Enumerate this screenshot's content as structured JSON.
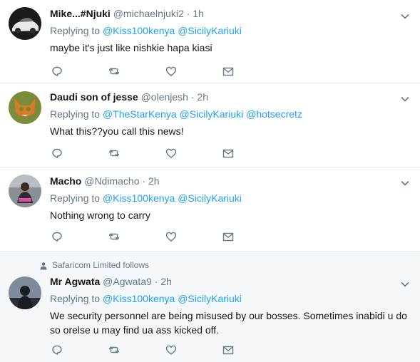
{
  "tweets": [
    {
      "name": "Mike...#Njuki",
      "handle": "@michaelnjuki2",
      "separator": "·",
      "time": "1h",
      "replying_prefix": "Replying to",
      "mentions": [
        "@Kiss100kenya",
        "@SicilyKariuki"
      ],
      "text": "maybe it's just like nishkie hapa kiasi",
      "avatar_icon": "car-avatar"
    },
    {
      "name": "Daudi son of jesse",
      "handle": "@olenjesh",
      "separator": "·",
      "time": "2h",
      "replying_prefix": "Replying to",
      "mentions": [
        "@TheStarKenya",
        "@SicilyKariuki",
        "@hotsecretz"
      ],
      "text": "What this??you call this news!",
      "avatar_icon": "fox-avatar"
    },
    {
      "name": "Macho",
      "handle": "@Ndimacho",
      "separator": "·",
      "time": "2h",
      "replying_prefix": "Replying to",
      "mentions": [
        "@Kiss100kenya",
        "@SicilyKariuki"
      ],
      "text": "Nothing wrong to carry",
      "avatar_icon": "person-avatar"
    },
    {
      "context": "Safaricom Limited follows",
      "name": "Mr Agwata",
      "handle": "@Agwata9",
      "separator": "·",
      "time": "2h",
      "replying_prefix": "Replying to",
      "mentions": [
        "@Kiss100kenya",
        "@SicilyKariuki"
      ],
      "text_lines": [
        "We security personnel are being misused by our bosses. Sometimes inabidi u do",
        "so orelse u may find ua ass kicked off."
      ],
      "avatar_icon": "silhouette-avatar"
    }
  ],
  "icons": {
    "reply": "reply-icon",
    "retweet": "retweet-icon",
    "like": "heart-icon",
    "dm": "envelope-icon",
    "more": "chevron-down-icon",
    "follows": "person-icon"
  },
  "colors": {
    "mention": "#1da1f2",
    "secondary_text": "#657786",
    "icon": "#657786",
    "divider": "#e6ecf0",
    "highlight_bg": "#f5f8fa"
  }
}
